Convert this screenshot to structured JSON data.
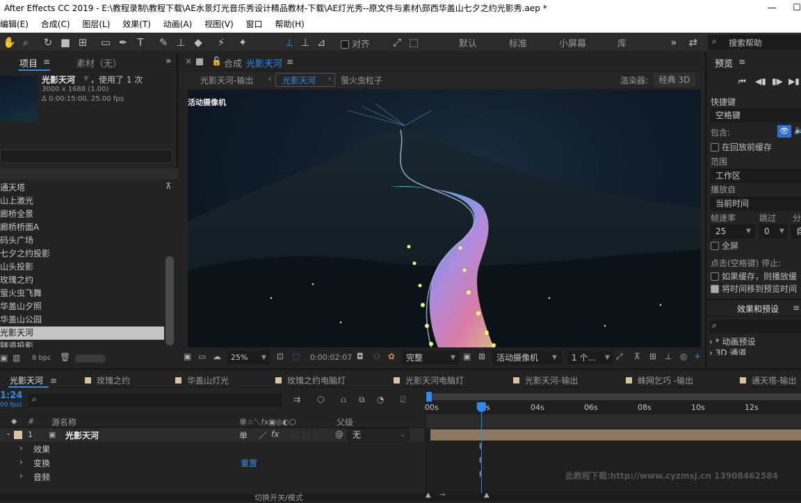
{
  "window": {
    "title": "After Effects CC 2019 - E:\\教程录制\\教程下载\\AE水景灯光音乐秀设计精品教材-下载\\AE灯光秀--原文件与素材\\郧西华盖山七夕之约光影秀.aep *",
    "minimize": "—",
    "maximize": "☐"
  },
  "menu": [
    "编辑(E)",
    "合成(C)",
    "图层(L)",
    "效果(T)",
    "动画(A)",
    "视图(V)",
    "窗口",
    "帮助(H)"
  ],
  "toolbar": {
    "align_label": "对齐",
    "workspaces": [
      "默认",
      "标准",
      "小屏幕",
      "库"
    ],
    "search_placeholder": "搜索帮助"
  },
  "project": {
    "tab_label": "项目",
    "footage_label": "素材（无）",
    "item_name": "光影天河",
    "used_times": "，使用了 1 次",
    "dimensions": "3000 x 1688 (1.00)",
    "duration": "Δ 0:00:15:00, 25.00 fps",
    "bit_depth": "8 bpc",
    "items": [
      "通天塔",
      "山上激光",
      "廊桥全景",
      "廊桥桥面A",
      "码头广场",
      "七夕之约投影",
      "山头投影",
      "玫瑰之约",
      "萤火虫飞舞",
      "华盖山夕照",
      "华盖山公园",
      "光影天河",
      "隧道投影"
    ],
    "selected_index": 11
  },
  "composition": {
    "header_prefix": "合成",
    "header_name": "光影天河",
    "breadcrumb": [
      "光影天河-输出",
      "光影天河",
      "萤火虫粒子"
    ],
    "renderer_label": "渲染器:",
    "renderer_value": "经典 3D",
    "camera_label": "活动摄像机",
    "zoom": "25%",
    "timecode": "0:00:02:07",
    "resolution": "完整",
    "view_camera": "活动摄像机",
    "views": "1 个..."
  },
  "preview": {
    "title": "预览",
    "shortcut_label": "快捷键",
    "shortcut_value": "空格键",
    "include_label": "包含:",
    "cache_before": "在回放前缓存",
    "range_label": "范围",
    "range_value": "工作区",
    "play_from_label": "播放自",
    "play_from_value": "当前时间",
    "framerate_label": "帧速率",
    "skip_label": "跳过",
    "res_label": "分",
    "framerate_value": "25",
    "skip_value": "0",
    "res_value": "自",
    "fullscreen": "全屏",
    "stop_label": "点击(空格键) 停止:",
    "stop_opt1": "如果缓存，则播放缓",
    "stop_opt2": "将时间移到预览时间",
    "effects_title": "效果和预设",
    "effects_items": [
      "* 动画预设",
      "3D 通道"
    ]
  },
  "timeline": {
    "tabs": [
      "光影天河",
      "玫瑰之约",
      "华盖山灯光",
      "玫瑰之约电脑灯",
      "光影天河电脑灯",
      "光影天河-输出",
      "蛛网乞巧 -输出",
      "通天塔-输出"
    ],
    "current_time": "1:24",
    "fps": "00 fps)",
    "col_num": "#",
    "col_source": "源名称",
    "col_switches": "单☆＼fx▣◎◐⬡",
    "col_parent": "父级",
    "layer_num": "1",
    "layer_name": "光影天河",
    "parent_value": "无",
    "props": [
      "效果",
      "变换",
      "音频"
    ],
    "reset_label": "重置",
    "ruler": [
      "00s",
      "02s",
      "04s",
      "06s",
      "08s",
      "10s",
      "12s"
    ],
    "toggle_label": "切换开关/模式",
    "watermark": "此教程下载:http://www.cyzmsj.cn 13908462584"
  },
  "colors": {
    "accent": "#2d8ceb",
    "panel_bg": "#232323",
    "selected_row": "#c5c5c5",
    "layer_bar": "#8a7a62"
  }
}
